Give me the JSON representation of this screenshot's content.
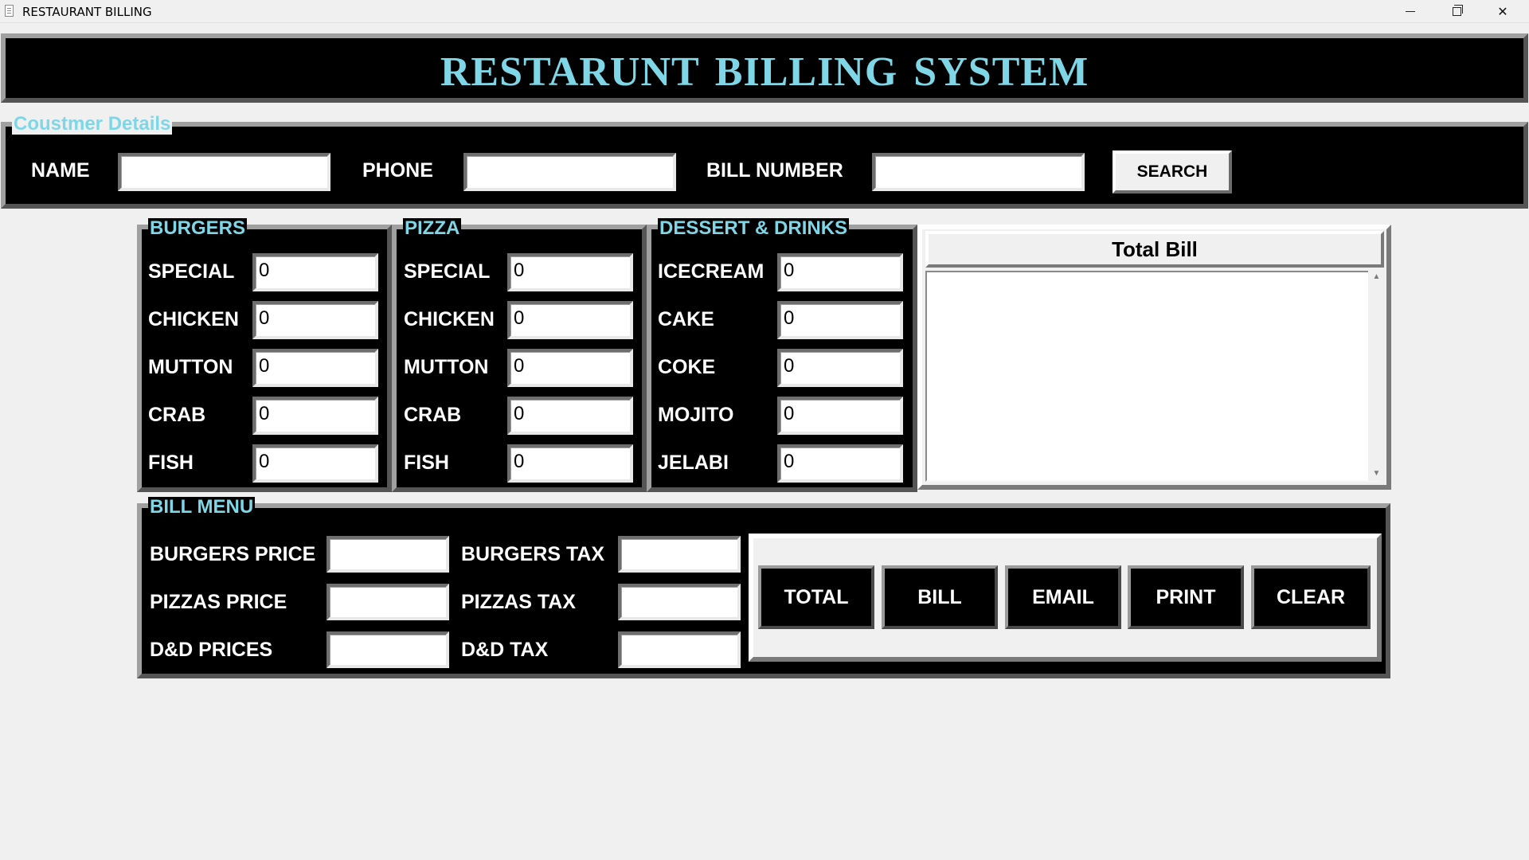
{
  "window": {
    "title": "RESTAURANT BILLING"
  },
  "header": {
    "title": "RESTARUNT BILLING  SYSTEM"
  },
  "customer": {
    "legend": "Coustmer Details",
    "name_label": "NAME",
    "name_value": "",
    "phone_label": "PHONE",
    "phone_value": "",
    "bill_number_label": "BILL NUMBER",
    "bill_number_value": "",
    "search_label": "SEARCH"
  },
  "burgers": {
    "legend": "BURGERS",
    "items": [
      {
        "label": "SPECIAL",
        "value": "0"
      },
      {
        "label": "CHICKEN",
        "value": "0"
      },
      {
        "label": "MUTTON",
        "value": "0"
      },
      {
        "label": "CRAB",
        "value": "0"
      },
      {
        "label": "FISH",
        "value": "0"
      }
    ]
  },
  "pizza": {
    "legend": "PIZZA",
    "items": [
      {
        "label": "SPECIAL",
        "value": "0"
      },
      {
        "label": "CHICKEN",
        "value": "0"
      },
      {
        "label": "MUTTON",
        "value": "0"
      },
      {
        "label": "CRAB",
        "value": "0"
      },
      {
        "label": "FISH",
        "value": "0"
      }
    ]
  },
  "desserts": {
    "legend": "DESSERT & DRINKS",
    "items": [
      {
        "label": "ICECREAM",
        "value": "0"
      },
      {
        "label": "CAKE",
        "value": "0"
      },
      {
        "label": "COKE",
        "value": "0"
      },
      {
        "label": "MOJITO",
        "value": "0"
      },
      {
        "label": "JELABI",
        "value": "0"
      }
    ]
  },
  "total_bill": {
    "heading": "Total Bill",
    "text": ""
  },
  "bill_menu": {
    "legend": "BILL MENU",
    "burgers_price_label": "BURGERS PRICE",
    "burgers_price_value": "",
    "pizzas_price_label": "PIZZAS PRICE",
    "pizzas_price_value": "",
    "dd_prices_label": "D&D PRICES",
    "dd_prices_value": "",
    "burgers_tax_label": "BURGERS TAX",
    "burgers_tax_value": "",
    "pizzas_tax_label": "PIZZAS TAX",
    "pizzas_tax_value": "",
    "dd_tax_label": "D&D TAX",
    "dd_tax_value": ""
  },
  "actions": {
    "total_label": "TOTAL",
    "bill_label": "BILL",
    "email_label": "EMAIL",
    "print_label": "PRINT",
    "clear_label": "CLEAR"
  },
  "colors": {
    "accent": "#7ed6e6",
    "panel": "#000000",
    "background": "#f0f0f0"
  },
  "icons": {
    "app": "document-icon",
    "minimize": "minimize-icon",
    "maximize": "restore-icon",
    "close": "close-icon"
  }
}
